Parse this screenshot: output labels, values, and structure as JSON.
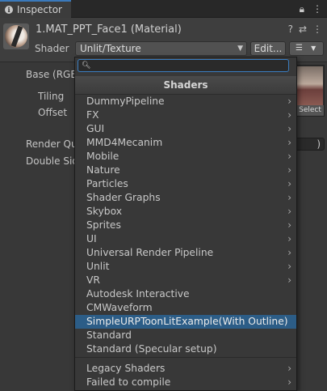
{
  "tab": {
    "title": "Inspector"
  },
  "header": {
    "material_name": "1.MAT_PPT_Face1 (Material)",
    "shader_label": "Shader",
    "shader_value": "Unlit/Texture",
    "edit_label": "Edit...",
    "help_icon": "help-icon",
    "settings_icon": "sliders-icon",
    "more_icon": "more-icon"
  },
  "properties": {
    "base": "Base (RGB)",
    "tiling": "Tiling",
    "offset": "Offset",
    "render_queue": "Render Queue",
    "double_sided": "Double Sided",
    "texture_select": "Select",
    "rq_value": ")"
  },
  "popup": {
    "search_placeholder": "",
    "heading": "Shaders",
    "folders": [
      {
        "label": "DummyPipeline"
      },
      {
        "label": "FX"
      },
      {
        "label": "GUI"
      },
      {
        "label": "MMD4Mecanim"
      },
      {
        "label": "Mobile"
      },
      {
        "label": "Nature"
      },
      {
        "label": "Particles"
      },
      {
        "label": "Shader Graphs"
      },
      {
        "label": "Skybox"
      },
      {
        "label": "Sprites"
      },
      {
        "label": "UI"
      },
      {
        "label": "Universal Render Pipeline"
      },
      {
        "label": "Unlit"
      },
      {
        "label": "VR"
      }
    ],
    "shaders": [
      {
        "label": "Autodesk Interactive"
      },
      {
        "label": "CMWaveform"
      },
      {
        "label": "SimpleURPToonLitExample(With Outline)"
      },
      {
        "label": "Standard"
      },
      {
        "label": "Standard (Specular setup)"
      }
    ],
    "footer": [
      {
        "label": "Legacy Shaders"
      },
      {
        "label": "Failed to compile"
      }
    ]
  },
  "colors": {
    "accent": "#3a79bb",
    "selection": "#2c5d87",
    "background": "#383838"
  }
}
